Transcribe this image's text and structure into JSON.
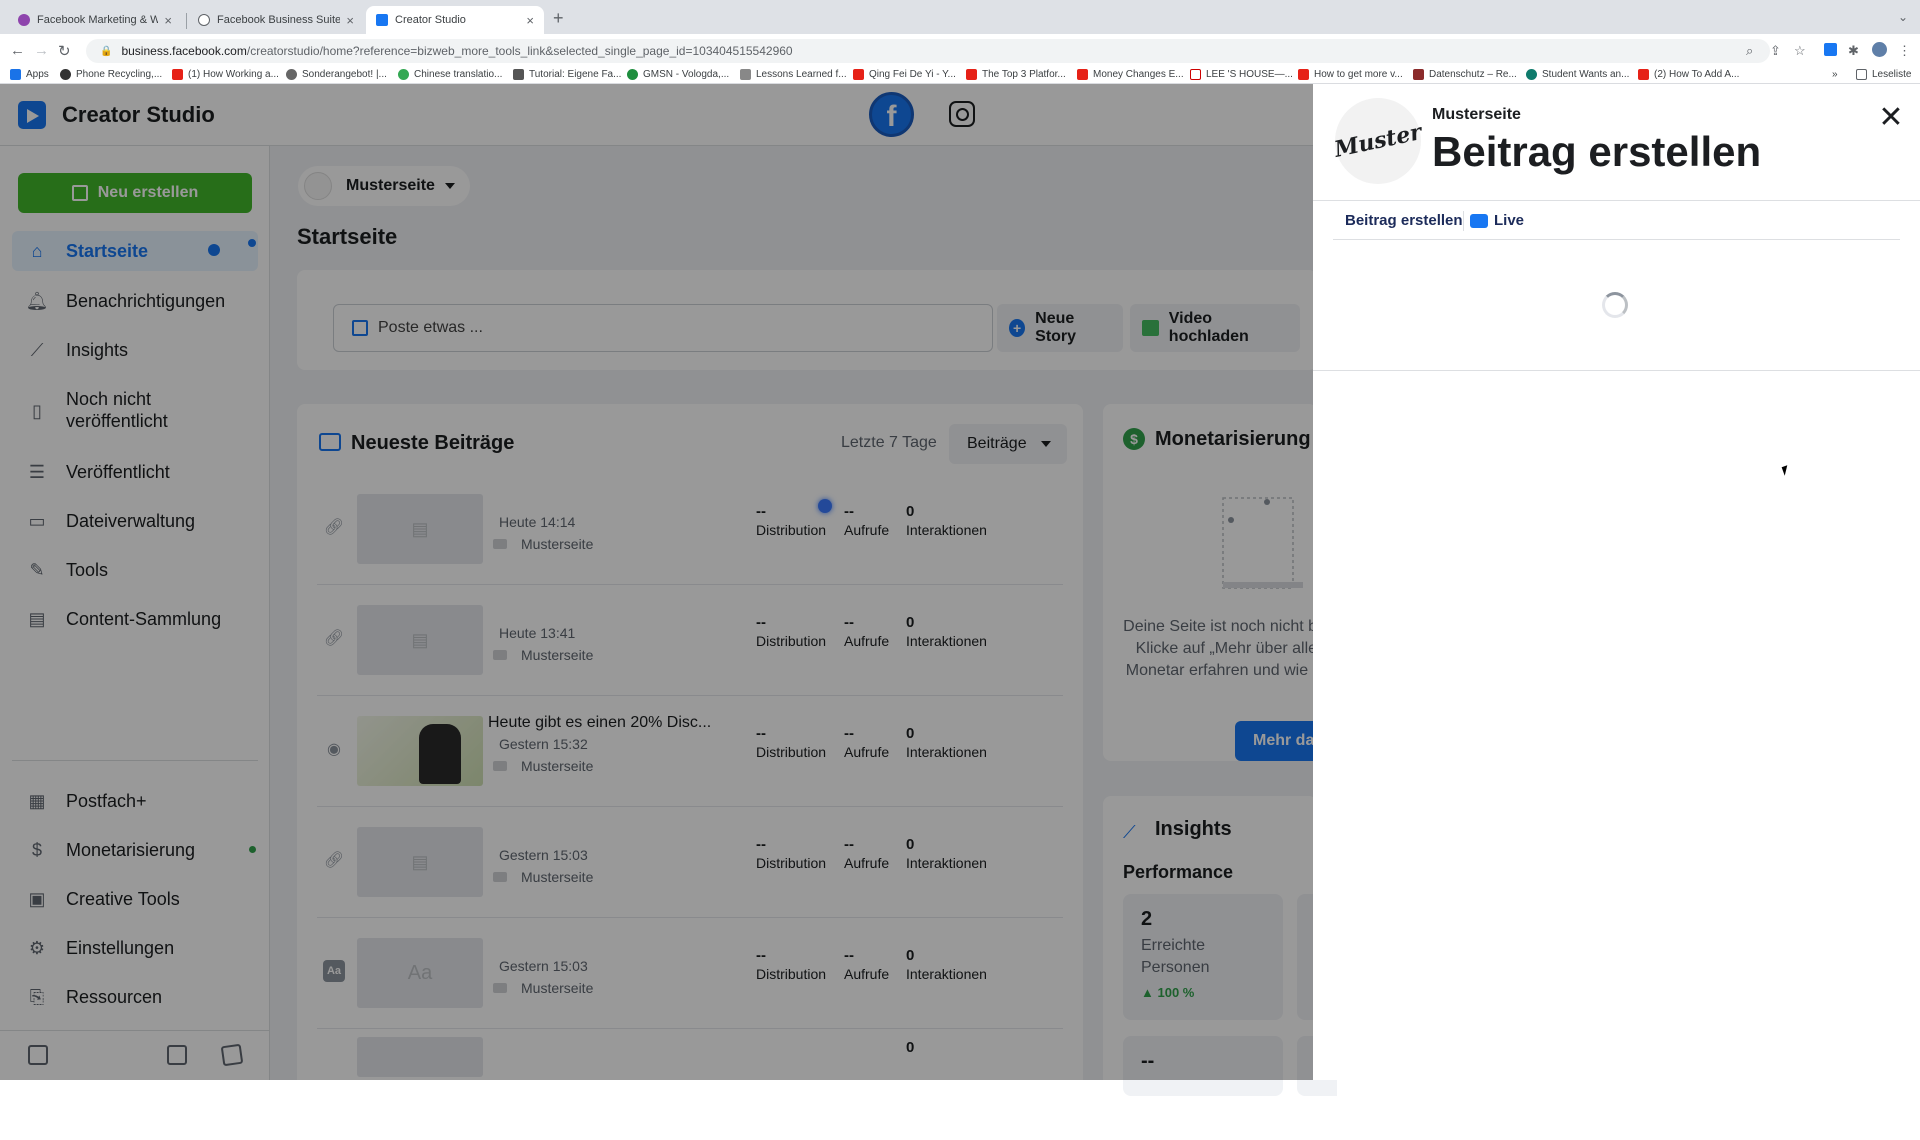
{
  "browser": {
    "tabs": [
      {
        "title": "Facebook Marketing & Werbe",
        "active": false
      },
      {
        "title": "Facebook Business Suite",
        "active": false
      },
      {
        "title": "Creator Studio",
        "active": true
      }
    ],
    "new_tab": "+",
    "url_host": "business.facebook.com",
    "url_path": "/creatorstudio/home?reference=bizweb_more_tools_link&selected_single_page_id=103404515542960",
    "bookmarks": [
      "Apps",
      "Phone Recycling,...",
      "(1) How Working a...",
      "Sonderangebot! |...",
      "Chinese translatio...",
      "Tutorial: Eigene Fa...",
      "GMSN - Vologda,...",
      "Lessons Learned f...",
      "Qing Fei De Yi - Y...",
      "The Top 3 Platfor...",
      "Money Changes E...",
      "LEE 'S HOUSE—...",
      "How to get more v...",
      "Datenschutz – Re...",
      "Student Wants an...",
      "(2) How To Add A..."
    ],
    "bookmarks_more": "»",
    "reading_list": "Leseliste"
  },
  "app": {
    "title": "Creator Studio",
    "new_button": "Neu erstellen",
    "nav": [
      {
        "label": "Startseite",
        "icon": "home-icon"
      },
      {
        "label": "Benachrichtigungen",
        "icon": "bell-icon"
      },
      {
        "label": "Insights",
        "icon": "chart-icon"
      },
      {
        "label": "Noch nicht veröffentlicht",
        "icon": "draft-icon"
      },
      {
        "label": "Veröffentlicht",
        "icon": "list-icon"
      },
      {
        "label": "Dateiverwaltung",
        "icon": "file-icon"
      },
      {
        "label": "Tools",
        "icon": "wrench-icon"
      },
      {
        "label": "Content-Sammlung",
        "icon": "collection-icon"
      },
      {
        "label": "Postfach+",
        "icon": "inbox-icon"
      },
      {
        "label": "Monetarisierung",
        "icon": "dollar-icon"
      },
      {
        "label": "Creative Tools",
        "icon": "creative-icon"
      },
      {
        "label": "Einstellungen",
        "icon": "gear-icon"
      },
      {
        "label": "Ressourcen",
        "icon": "resources-icon"
      }
    ]
  },
  "main": {
    "page_name": "Musterseite",
    "home_title": "Startseite",
    "composer": {
      "placeholder": "Poste etwas ...",
      "story_button": "Neue Story",
      "video_button": "Video hochladen"
    },
    "posts": {
      "title": "Neueste Beiträge",
      "range": "Letzte 7 Tage",
      "type_select": "Beiträge",
      "rows": [
        {
          "text": "",
          "time": "Heute 14:14",
          "page": "Musterseite",
          "dist": "--",
          "dist_label": "Distribution",
          "views": "--",
          "views_label": "Aufrufe",
          "inter": "0",
          "inter_label": "Interaktionen"
        },
        {
          "text": "",
          "time": "Heute 13:41",
          "page": "Musterseite",
          "dist": "--",
          "dist_label": "Distribution",
          "views": "--",
          "views_label": "Aufrufe",
          "inter": "0",
          "inter_label": "Interaktionen"
        },
        {
          "text": "Heute gibt es einen 20% Disc...",
          "time": "Gestern 15:32",
          "page": "Musterseite",
          "dist": "--",
          "dist_label": "Distribution",
          "views": "--",
          "views_label": "Aufrufe",
          "inter": "0",
          "inter_label": "Interaktionen"
        },
        {
          "text": "",
          "time": "Gestern 15:03",
          "page": "Musterseite",
          "dist": "--",
          "dist_label": "Distribution",
          "views": "--",
          "views_label": "Aufrufe",
          "inter": "0",
          "inter_label": "Interaktionen"
        },
        {
          "text": "",
          "time": "Gestern 15:03",
          "page": "Musterseite",
          "dist": "--",
          "dist_label": "Distribution",
          "views": "--",
          "views_label": "Aufrufe",
          "inter": "0",
          "inter_label": "Interaktionen"
        }
      ],
      "thumb_text_label": "Aa",
      "partial_row_inter": "0"
    },
    "monetization": {
      "title": "Monetarisierung",
      "text": "Deine Seite ist noch nicht berechtigt. Klicke auf „Mehr über alle unsere Monetar erfahren und wie du Zugan",
      "button": "Mehr da"
    },
    "insights": {
      "title": "Insights",
      "performance": "Performance",
      "reach_value": "2",
      "reach_label": "Erreichte Personen",
      "reach_change": "▲ 100 %",
      "second_value": "--"
    }
  },
  "panel": {
    "page_name": "Musterseite",
    "avatar_text": "Muster",
    "title": "Beitrag erstellen",
    "tab_post": "Beitrag erstellen",
    "tab_live": "Live",
    "close": "✕"
  }
}
